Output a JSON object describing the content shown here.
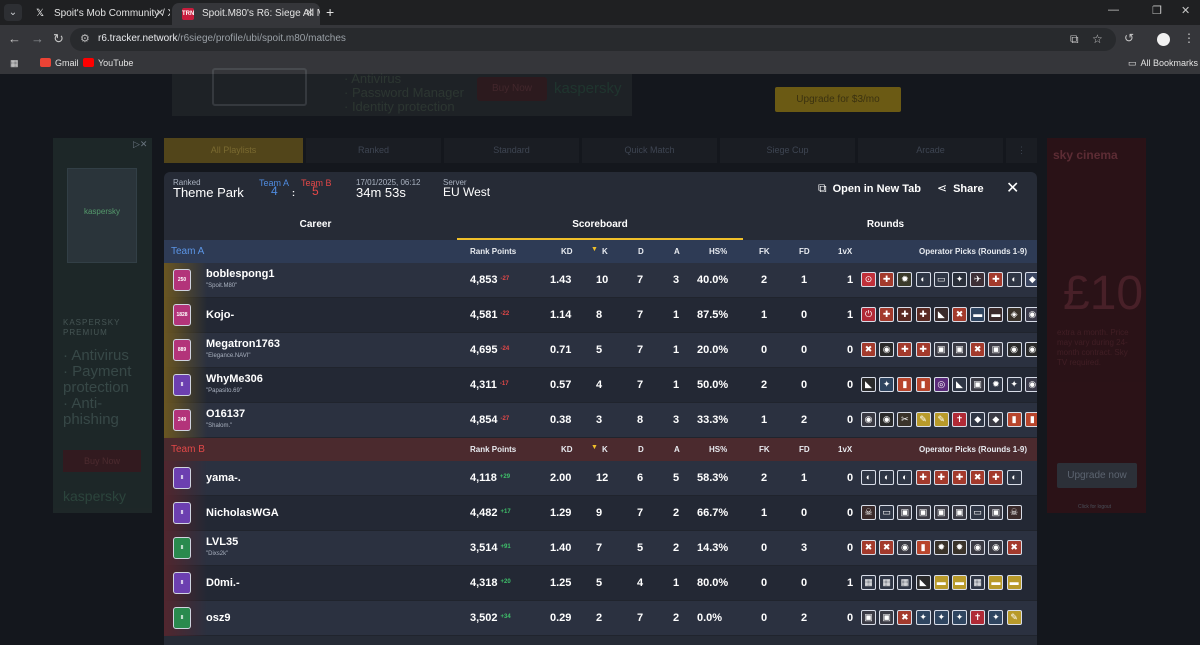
{
  "browser": {
    "tabs": [
      {
        "title": "Spoit's Mob Community / X",
        "icon": "x-logo-icon",
        "icon_char": "𝕏",
        "active": false
      },
      {
        "title": "Spoit.M80's R6: Siege All Matche",
        "icon": "r6-tracker-icon",
        "icon_char": "TRN",
        "active": true
      }
    ],
    "url_host": "r6.tracker.network",
    "url_path": "/r6siege/profile/ubi/spoit.m80/matches",
    "bookmarks": [
      {
        "label": "Gmail",
        "icon": "gmail-icon",
        "color": "#ea4335"
      },
      {
        "label": "YouTube",
        "icon": "youtube-icon",
        "color": "#ff0000"
      }
    ],
    "all_bookmarks": "All Bookmarks"
  },
  "background_page": {
    "playlists": [
      {
        "label": "All Playlists",
        "active": true
      },
      {
        "label": "Ranked",
        "active": false
      },
      {
        "label": "Standard",
        "active": false
      },
      {
        "label": "Quick Match",
        "active": false
      },
      {
        "label": "Siege Cup",
        "active": false
      },
      {
        "label": "Arcade",
        "active": false
      }
    ],
    "ad_top": {
      "lines": [
        "· Antivirus",
        "· Password Manager",
        "· Identity protection"
      ],
      "buy": "Buy Now",
      "brand": "kaspersky"
    },
    "upgrade_top": "Upgrade for $3/mo",
    "ad_left": {
      "product": "kaspersky",
      "premium": "KASPERSKY PREMIUM",
      "features": [
        "· Antivirus",
        "· Payment protection",
        "· Anti-phishing"
      ],
      "buy": "Buy Now",
      "brand": "kaspersky"
    },
    "ad_right": {
      "brand": "sky cinema",
      "price": "£10",
      "fine_print": "extra a month. Price may vary during 24-month contract. Sky TV required."
    },
    "upgrade_right": "Upgrade now",
    "right_note": "Click for logout"
  },
  "match": {
    "mode_label": "Ranked",
    "map": "Theme Park",
    "team_a_label": "Team A",
    "team_b_label": "Team B",
    "team_a_score": "4",
    "team_b_score": "5",
    "score_sep": ":",
    "datetime": "17/01/2025, 06:12",
    "duration": "34m 53s",
    "server_label": "Server",
    "server": "EU West",
    "open_new_tab": "Open in New Tab",
    "share": "Share",
    "tabs": [
      "Career",
      "Scoreboard",
      "Rounds"
    ],
    "active_tab": "Scoreboard"
  },
  "columns": {
    "rank_points": "Rank Points",
    "kd": "KD",
    "k": "K",
    "d": "D",
    "a": "A",
    "hs": "HS%",
    "fk": "FK",
    "fd": "FD",
    "onevx": "1vX",
    "ops": "Operator Picks (Rounds 1-9)"
  },
  "team_a": {
    "name": "Team A",
    "players": [
      {
        "name": "boblespong1",
        "sub": "\"Spoit.M80\"",
        "rank": "250",
        "rank_color": "pink",
        "rp": "4,853",
        "delta": "-27",
        "kd": "1.43",
        "k": "10",
        "d": "7",
        "a": "3",
        "hs": "40.0%",
        "fk": "2",
        "fd": "1",
        "onevx": "1",
        "ops": [
          [
            "#c0303a",
            "⊙"
          ],
          [
            "#a33a2c",
            "✚"
          ],
          [
            "#3a3a2a",
            "✹"
          ],
          [
            "#2f3645",
            "◐"
          ],
          [
            "#2f3645",
            "▭"
          ],
          [
            "#2a2f3a",
            "✦"
          ],
          [
            "#3d2f36",
            "✈"
          ],
          [
            "#a33a2c",
            "✚"
          ],
          [
            "#2f3645",
            "◐"
          ],
          [
            "#3a4560",
            "◆"
          ]
        ]
      },
      {
        "name": "Kojo-",
        "sub": "",
        "rank": "1828",
        "rank_color": "pink",
        "rp": "4,581",
        "delta": "-22",
        "kd": "1.14",
        "k": "8",
        "d": "7",
        "a": "1",
        "hs": "87.5%",
        "fk": "1",
        "fd": "0",
        "onevx": "1",
        "ops": [
          [
            "#b02a36",
            "⏻"
          ],
          [
            "#a33a2c",
            "✚"
          ],
          [
            "#5a2a22",
            "✚"
          ],
          [
            "#5a2a22",
            "✚"
          ],
          [
            "#3a2a2a",
            "◣"
          ],
          [
            "#a33a2c",
            "✖"
          ],
          [
            "#2f4560",
            "▬"
          ],
          [
            "#3a2a2a",
            "▬"
          ],
          [
            "#3a332a",
            "◈"
          ],
          [
            "#3a3a4a",
            "◉"
          ]
        ]
      },
      {
        "name": "Megatron1763",
        "sub": "\"Elegance.NAVI\"",
        "rank": "889",
        "rank_color": "pink",
        "rp": "4,695",
        "delta": "-24",
        "kd": "0.71",
        "k": "5",
        "d": "7",
        "a": "1",
        "hs": "20.0%",
        "fk": "0",
        "fd": "0",
        "onevx": "0",
        "ops": [
          [
            "#a33a2c",
            "✖"
          ],
          [
            "#2a2a2a",
            "◉"
          ],
          [
            "#a33a2c",
            "✚"
          ],
          [
            "#a33a2c",
            "✚"
          ],
          [
            "#3a3a44",
            "▣"
          ],
          [
            "#3a3a44",
            "▣"
          ],
          [
            "#a33a2c",
            "✖"
          ],
          [
            "#3a3a44",
            "▣"
          ],
          [
            "#2a2a2a",
            "◉"
          ],
          [
            "#2a2a2a",
            "◉"
          ]
        ]
      },
      {
        "name": "WhyMe306",
        "sub": "\"Papasito.69\"",
        "rank": "II",
        "rank_color": "purple",
        "rp": "4,311",
        "delta": "-17",
        "kd": "0.57",
        "k": "4",
        "d": "7",
        "a": "1",
        "hs": "50.0%",
        "fk": "2",
        "fd": "0",
        "onevx": "0",
        "ops": [
          [
            "#2a2a2a",
            "◣"
          ],
          [
            "#2f4560",
            "✦"
          ],
          [
            "#b8452c",
            "▮"
          ],
          [
            "#b8452c",
            "▮"
          ],
          [
            "#5a2a7a",
            "◎"
          ],
          [
            "#2f3645",
            "◣"
          ],
          [
            "#3a3a44",
            "▣"
          ],
          [
            "#2f3645",
            "✹"
          ],
          [
            "#2f3645",
            "✦"
          ],
          [
            "#3a3a4a",
            "◉"
          ]
        ]
      },
      {
        "name": "O16137",
        "sub": "\"Shalom.\"",
        "rank": "249",
        "rank_color": "pink",
        "rp": "4,854",
        "delta": "-27",
        "kd": "0.38",
        "k": "3",
        "d": "8",
        "a": "3",
        "hs": "33.3%",
        "fk": "1",
        "fd": "2",
        "onevx": "0",
        "ops": [
          [
            "#3a3a44",
            "◉"
          ],
          [
            "#2a2a2a",
            "◉"
          ],
          [
            "#3a332a",
            "✂"
          ],
          [
            "#b89a2a",
            "✎"
          ],
          [
            "#b89a2a",
            "✎"
          ],
          [
            "#b02a36",
            "✝"
          ],
          [
            "#2f3645",
            "◆"
          ],
          [
            "#3a3a44",
            "◆"
          ],
          [
            "#b8452c",
            "▮"
          ],
          [
            "#b8452c",
            "▮"
          ]
        ]
      }
    ]
  },
  "team_b": {
    "name": "Team B",
    "players": [
      {
        "name": "yama-.",
        "sub": "",
        "rank": "II",
        "rank_color": "purple",
        "rp": "4,118",
        "delta": "+29",
        "kd": "2.00",
        "k": "12",
        "d": "6",
        "a": "5",
        "hs": "58.3%",
        "fk": "2",
        "fd": "1",
        "onevx": "0",
        "ops": [
          [
            "#2f3645",
            "◐"
          ],
          [
            "#2f3645",
            "◐"
          ],
          [
            "#2f3645",
            "◐"
          ],
          [
            "#a33a2c",
            "✚"
          ],
          [
            "#a33a2c",
            "✚"
          ],
          [
            "#a33a2c",
            "✚"
          ],
          [
            "#a33a2c",
            "✖"
          ],
          [
            "#a33a2c",
            "✚"
          ],
          [
            "#2f3645",
            "◐"
          ]
        ]
      },
      {
        "name": "NicholasWGA",
        "sub": "",
        "rank": "II",
        "rank_color": "purple",
        "rp": "4,482",
        "delta": "+17",
        "kd": "1.29",
        "k": "9",
        "d": "7",
        "a": "2",
        "hs": "66.7%",
        "fk": "1",
        "fd": "0",
        "onevx": "0",
        "ops": [
          [
            "#3a2a2a",
            "☠"
          ],
          [
            "#2f3645",
            "▭"
          ],
          [
            "#3a3a44",
            "▣"
          ],
          [
            "#3a3a44",
            "▣"
          ],
          [
            "#3a3a44",
            "▣"
          ],
          [
            "#3a3a44",
            "▣"
          ],
          [
            "#2f3645",
            "▭"
          ],
          [
            "#3a3a44",
            "▣"
          ],
          [
            "#3a2a2a",
            "☠"
          ]
        ]
      },
      {
        "name": "LVL35",
        "sub": "\"Dixs2k\"",
        "rank": "II",
        "rank_color": "green",
        "rp": "3,514",
        "delta": "+91",
        "kd": "1.40",
        "k": "7",
        "d": "5",
        "a": "2",
        "hs": "14.3%",
        "fk": "0",
        "fd": "3",
        "onevx": "0",
        "ops": [
          [
            "#a33a2c",
            "✖"
          ],
          [
            "#a33a2c",
            "✖"
          ],
          [
            "#3a3a44",
            "◉"
          ],
          [
            "#b8452c",
            "▮"
          ],
          [
            "#3a332a",
            "✹"
          ],
          [
            "#3a332a",
            "✹"
          ],
          [
            "#3a3a44",
            "◉"
          ],
          [
            "#3a3a44",
            "◉"
          ],
          [
            "#a33a2c",
            "✖"
          ]
        ]
      },
      {
        "name": "D0mi.-",
        "sub": "",
        "rank": "II",
        "rank_color": "purple",
        "rp": "4,318",
        "delta": "+20",
        "kd": "1.25",
        "k": "5",
        "d": "4",
        "a": "1",
        "hs": "80.0%",
        "fk": "0",
        "fd": "0",
        "onevx": "1",
        "ops": [
          [
            "#2f3645",
            "▦"
          ],
          [
            "#2f3645",
            "▦"
          ],
          [
            "#2f3645",
            "▦"
          ],
          [
            "#2a2a2a",
            "◣"
          ],
          [
            "#b89a2a",
            "▬"
          ],
          [
            "#b89a2a",
            "▬"
          ],
          [
            "#2f3645",
            "▦"
          ],
          [
            "#b89a2a",
            "▬"
          ],
          [
            "#b89a2a",
            "▬"
          ]
        ]
      },
      {
        "name": "osz9",
        "sub": "",
        "rank": "II",
        "rank_color": "green",
        "rp": "3,502",
        "delta": "+34",
        "kd": "0.29",
        "k": "2",
        "d": "7",
        "a": "2",
        "hs": "0.0%",
        "fk": "0",
        "fd": "2",
        "onevx": "0",
        "ops": [
          [
            "#3a3a44",
            "▣"
          ],
          [
            "#3a3a44",
            "▣"
          ],
          [
            "#a33a2c",
            "✖"
          ],
          [
            "#2f4560",
            "✦"
          ],
          [
            "#2f4560",
            "✦"
          ],
          [
            "#2f4560",
            "✦"
          ],
          [
            "#b02a36",
            "✝"
          ],
          [
            "#2f4560",
            "✦"
          ],
          [
            "#b89a2a",
            "✎"
          ]
        ]
      }
    ]
  }
}
